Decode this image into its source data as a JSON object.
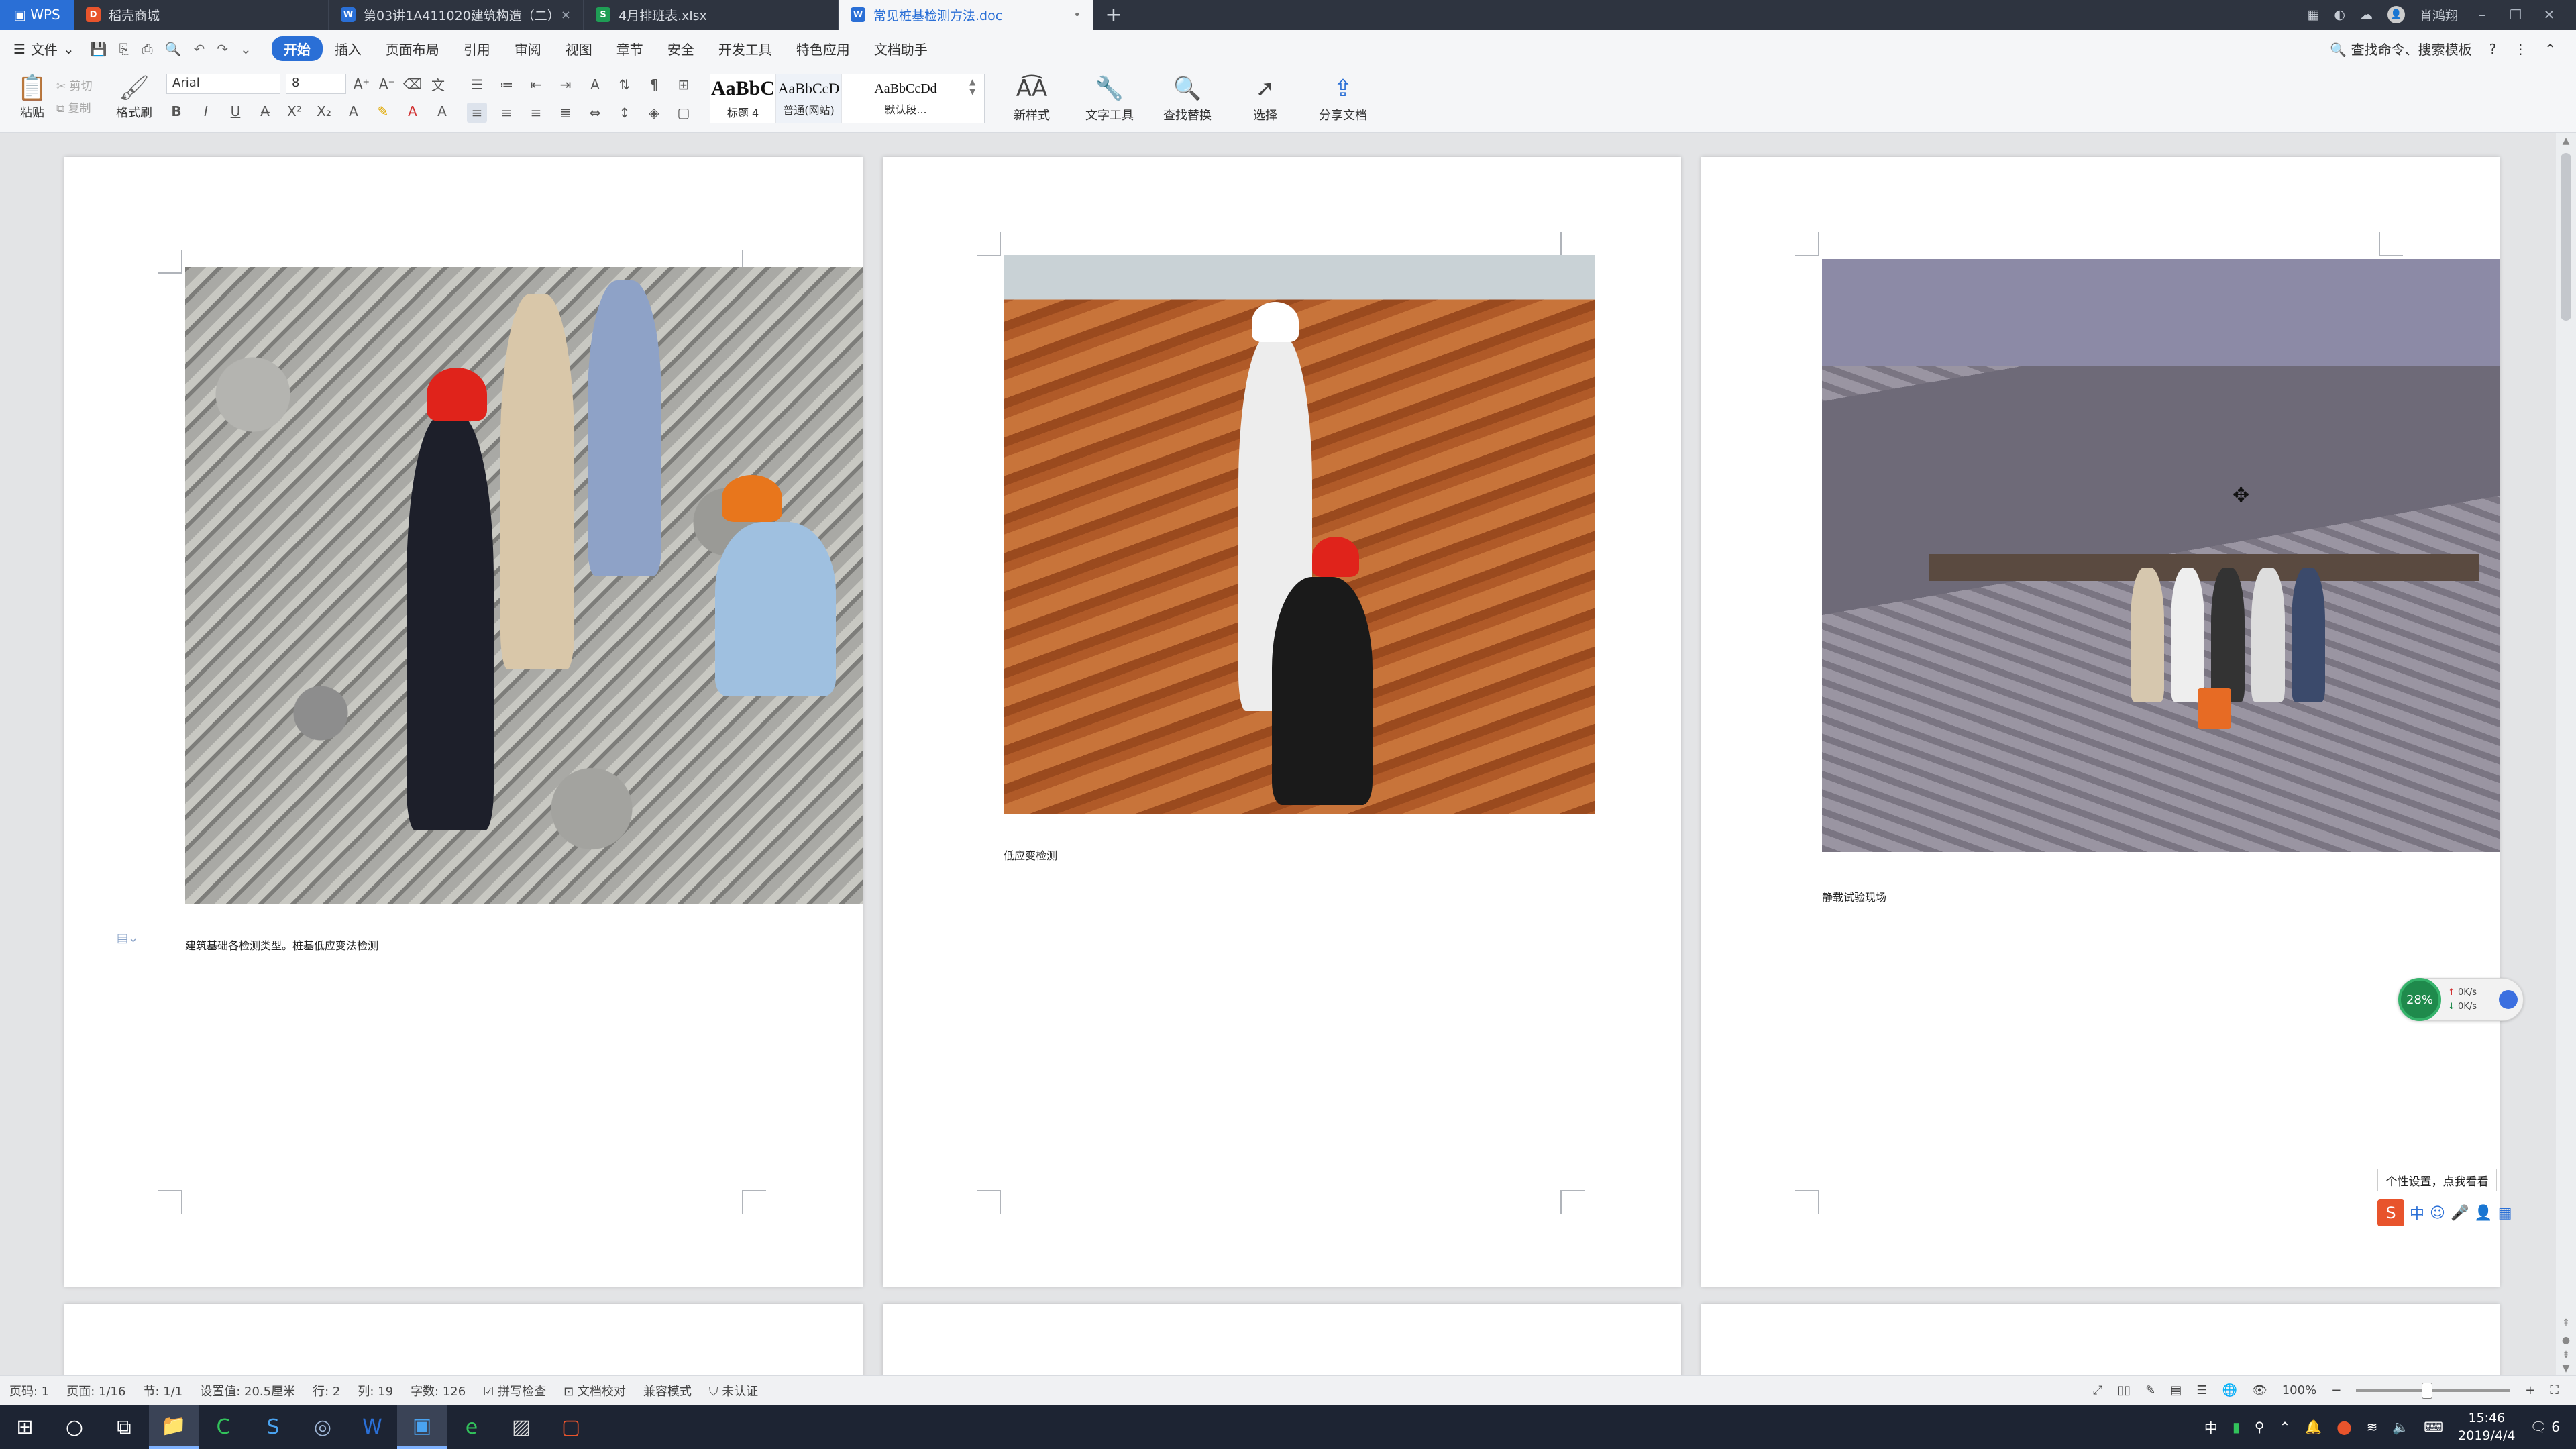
{
  "titlebar": {
    "app_label": "WPS",
    "tabs": [
      {
        "label": "稻壳商城",
        "icon": "docer-icon",
        "active": false
      },
      {
        "label": "第03讲1A411020建筑构造（二）",
        "icon": "wps-doc-icon",
        "active": false
      },
      {
        "label": "4月排班表.xlsx",
        "icon": "spreadsheet-icon",
        "active": false
      },
      {
        "label": "常见桩基检测方法.doc",
        "icon": "wps-doc-icon",
        "active": true
      }
    ],
    "user_name": "肖鸿翔"
  },
  "menubar": {
    "file_label": "文件",
    "items": [
      "开始",
      "插入",
      "页面布局",
      "引用",
      "审阅",
      "视图",
      "章节",
      "安全",
      "开发工具",
      "特色应用",
      "文档助手"
    ],
    "active_item": "开始",
    "search_label": "查找命令、搜索模板"
  },
  "ribbon": {
    "paste_label": "粘贴",
    "cut_label": "剪切",
    "copy_label": "复制",
    "format_painter_label": "格式刷",
    "font_name": "Arial",
    "font_size": "8",
    "styles": [
      {
        "preview": "AaBbC",
        "label": "标题 4"
      },
      {
        "preview": "AaBbCcD",
        "label": "普通(网站)"
      },
      {
        "preview": "AaBbCcDd",
        "label": "默认段..."
      }
    ],
    "new_style_label": "新样式",
    "text_tools_label": "文字工具",
    "find_replace_label": "查找替换",
    "select_label": "选择",
    "share_label": "分享文档"
  },
  "document": {
    "captions": [
      "建筑基础各检测类型。桩基低应变法检测",
      "低应变检测",
      "静载试验现场"
    ]
  },
  "widgets": {
    "net_percent": "28%",
    "upload_rate": "0K/s",
    "download_rate": "0K/s",
    "ime_tip": "个性设置，点我看看",
    "ime_mode": "中"
  },
  "statusbar": {
    "page_no": "页码: 1",
    "pages": "页面: 1/16",
    "section": "节: 1/1",
    "setting": "设置值: 20.5厘米",
    "row": "行: 2",
    "col": "列: 19",
    "word_count": "字数: 126",
    "spell_check": "拼写检查",
    "doc_proof": "文档校对",
    "compat_mode": "兼容模式",
    "cert": "未认证",
    "zoom": "100%"
  },
  "taskbar": {
    "time": "15:46",
    "date": "2019/4/4",
    "ime_lang": "中",
    "notification_count": "6"
  }
}
